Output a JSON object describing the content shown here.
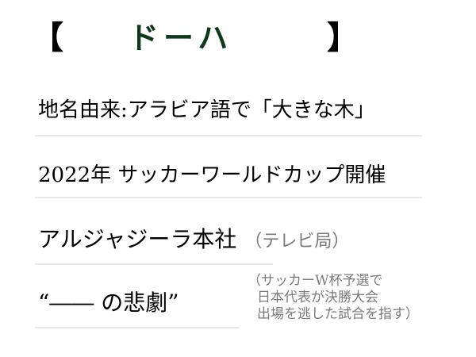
{
  "title": {
    "bracket_left": "【",
    "text": "ドーハ",
    "bracket_right": "】",
    "color": "#0e3a1a"
  },
  "lines": [
    "地名由来:アラビア語で「大きな木」",
    "2022年 サッカーワールドカップ開催",
    "アルジャジーラ本社"
  ],
  "line3_note": "（テレビ局）",
  "line4": "“―― の悲劇”",
  "side_note": [
    "（サッカーW杯予選で",
    "日本代表が決勝大会",
    "出場を逃した試合を指す）"
  ]
}
